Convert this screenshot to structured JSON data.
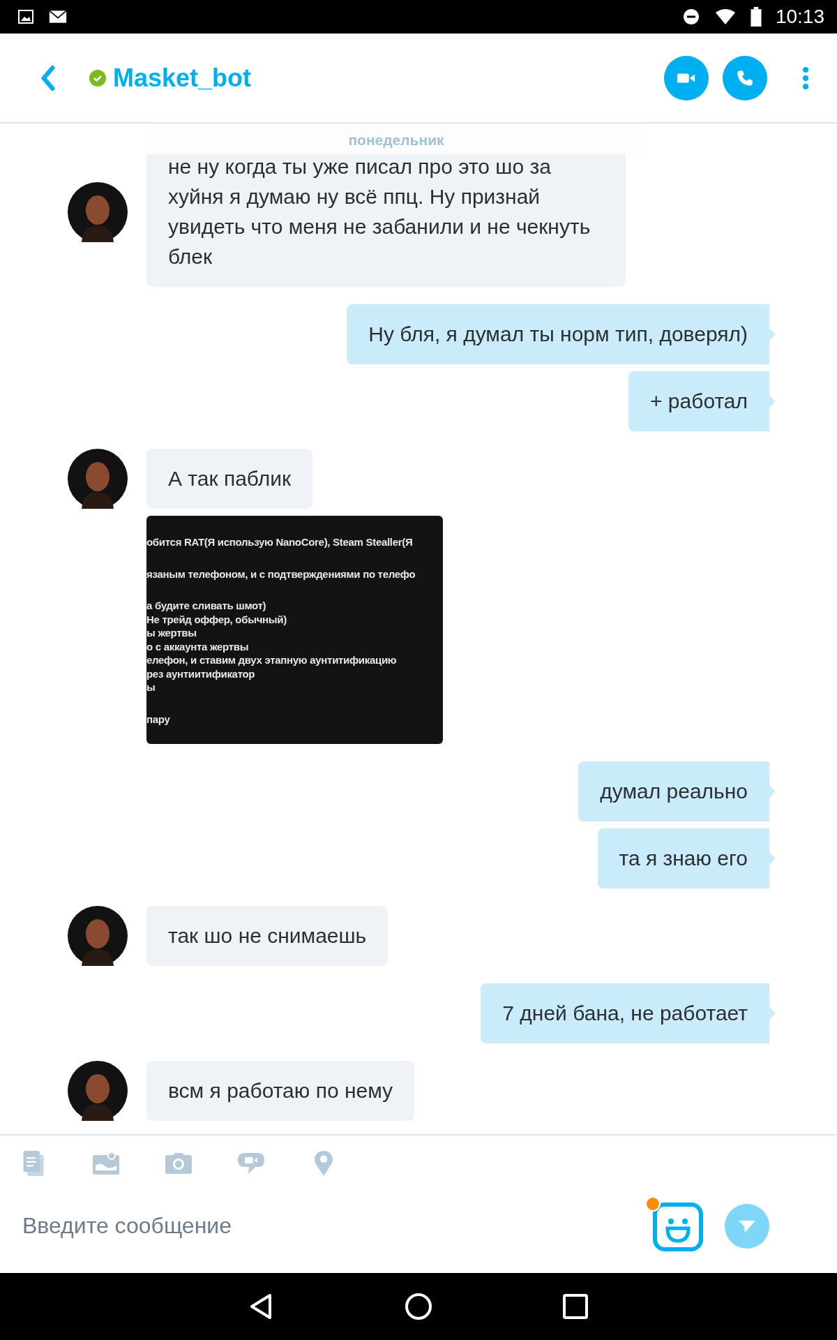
{
  "status_bar": {
    "time": "10:13"
  },
  "header": {
    "contact": "Masket_bot",
    "online": true
  },
  "date_divider": "понедельник",
  "messages": [
    {
      "kind": "received",
      "text": "не ну когда ты уже писал про это шо за хуйня я думаю ну всё ппц. Ну признай увидеть что меня не забанили и не чекнуть блек"
    },
    {
      "kind": "sent",
      "text": "Ну бля, я думал ты норм тип, доверял)"
    },
    {
      "kind": "sent",
      "text": "+ работал"
    },
    {
      "kind": "received",
      "text": "А так паблик"
    },
    {
      "kind": "received_image",
      "paragraphs": [
        {
          "lines": [
            "обится RAT(Я использую NanoCore), Steam Stealler(Я"
          ]
        },
        {
          "lines": [
            "язаным телефоном, и с подтверждениями по телефо"
          ]
        },
        {
          "lines": [
            "а будите сливать шмот)",
            "Не трейд оффер, обычный)",
            "ы жертвы",
            "о с аккаунта жертвы",
            "елефон, и ставим двух этапную аунтитификацию",
            "рез аунтиитификатор",
            "ы"
          ]
        },
        {
          "lines": [
            "пару"
          ]
        }
      ]
    },
    {
      "kind": "sent",
      "text": "думал реально"
    },
    {
      "kind": "sent",
      "text": "та я знаю его"
    },
    {
      "kind": "received",
      "text": "так шо не снимаешь"
    },
    {
      "kind": "sent",
      "text": "7 дней бана, не работает"
    },
    {
      "kind": "received",
      "text": "всм я работаю по нему"
    }
  ],
  "composer": {
    "placeholder": "Введите сообщение",
    "emoticon_badge": true
  }
}
